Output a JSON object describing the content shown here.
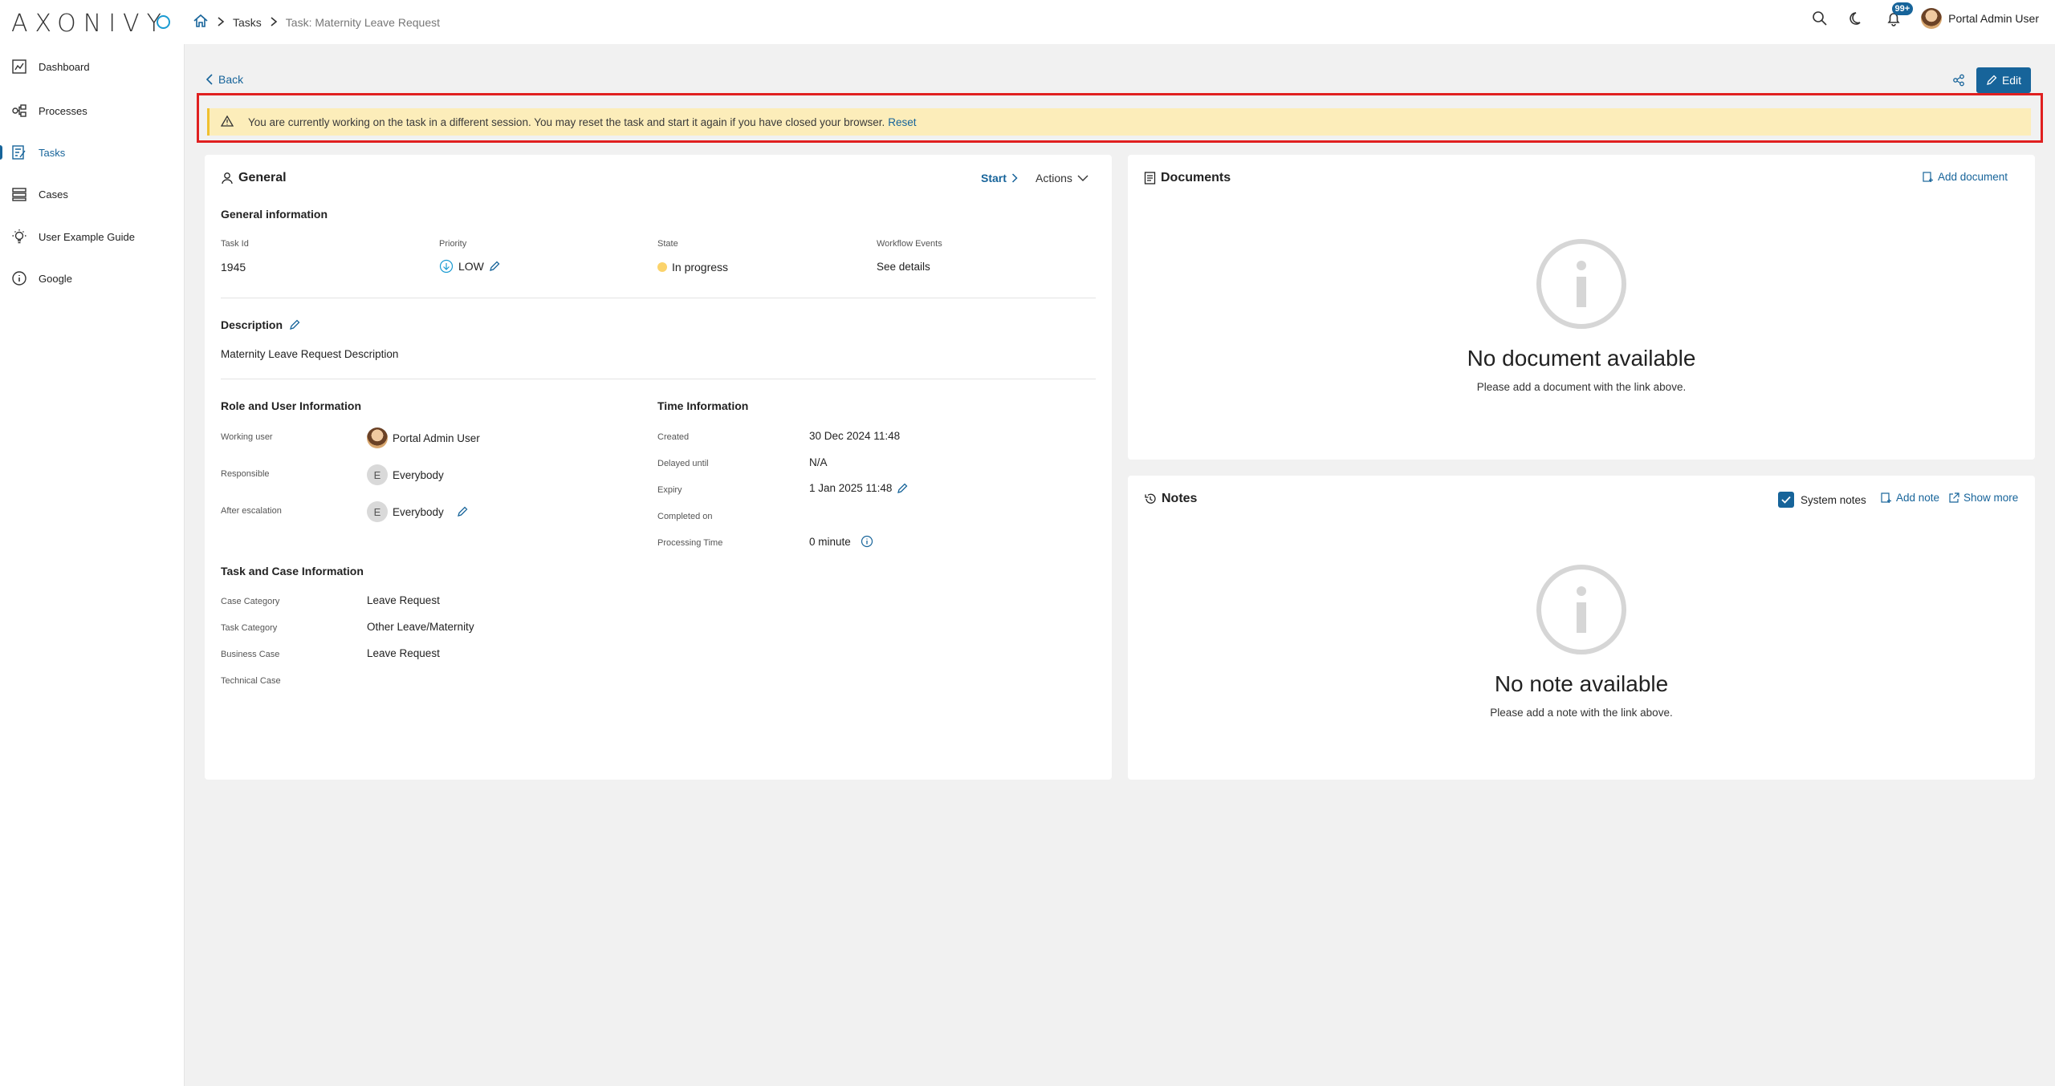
{
  "app": {
    "logo": "AXONIVY"
  },
  "breadcrumb": {
    "tasks": "Tasks",
    "current": "Task: Maternity Leave Request"
  },
  "topbar": {
    "notifications_count": "99+",
    "user_name": "Portal Admin User"
  },
  "sidebar": {
    "items": [
      {
        "label": "Dashboard",
        "icon": "dashboard-icon"
      },
      {
        "label": "Processes",
        "icon": "processes-icon"
      },
      {
        "label": "Tasks",
        "icon": "tasks-icon",
        "active": true
      },
      {
        "label": "Cases",
        "icon": "cases-icon"
      },
      {
        "label": "User Example Guide",
        "icon": "lightbulb-icon"
      },
      {
        "label": "Google",
        "icon": "info-icon"
      }
    ]
  },
  "actions": {
    "back": "Back",
    "edit": "Edit"
  },
  "alert": {
    "message": "You are currently working on the task in a different session. You may reset the task and start it again if you have closed your browser.",
    "reset": "Reset"
  },
  "general": {
    "title": "General",
    "start": "Start",
    "actions": "Actions",
    "info_title": "General information",
    "task_id_label": "Task Id",
    "task_id": "1945",
    "priority_label": "Priority",
    "priority": "LOW",
    "state_label": "State",
    "state": "In progress",
    "workflow_label": "Workflow Events",
    "workflow_link": "See details",
    "description_title": "Description",
    "description": "Maternity Leave Request Description",
    "role_title": "Role and User Information",
    "working_user_label": "Working user",
    "working_user": "Portal Admin User",
    "responsible_label": "Responsible",
    "responsible": "Everybody",
    "responsible_initial": "E",
    "after_escalation_label": "After escalation",
    "after_escalation": "Everybody",
    "after_escalation_initial": "E",
    "time_title": "Time Information",
    "created_label": "Created",
    "created": "30 Dec 2024 11:48",
    "delayed_label": "Delayed until",
    "delayed": "N/A",
    "expiry_label": "Expiry",
    "expiry": "1 Jan 2025 11:48",
    "completed_label": "Completed on",
    "completed": "",
    "processing_label": "Processing Time",
    "processing": "0 minute",
    "taskcase_title": "Task and Case Information",
    "case_category_label": "Case Category",
    "case_category": "Leave Request",
    "task_category_label": "Task Category",
    "task_category": "Other Leave/Maternity",
    "business_case_label": "Business Case",
    "business_case": "Leave Request",
    "technical_case_label": "Technical Case",
    "technical_case": ""
  },
  "documents": {
    "title": "Documents",
    "add": "Add document",
    "empty_title": "No document available",
    "empty_sub": "Please add a document with the link above."
  },
  "notes": {
    "title": "Notes",
    "system_notes": "System notes",
    "add": "Add note",
    "show_more": "Show more",
    "empty_title": "No note available",
    "empty_sub": "Please add a note with the link above."
  },
  "colors": {
    "accent": "#17649a",
    "alert_bg": "#fcedba",
    "highlight_border": "#e02020"
  }
}
